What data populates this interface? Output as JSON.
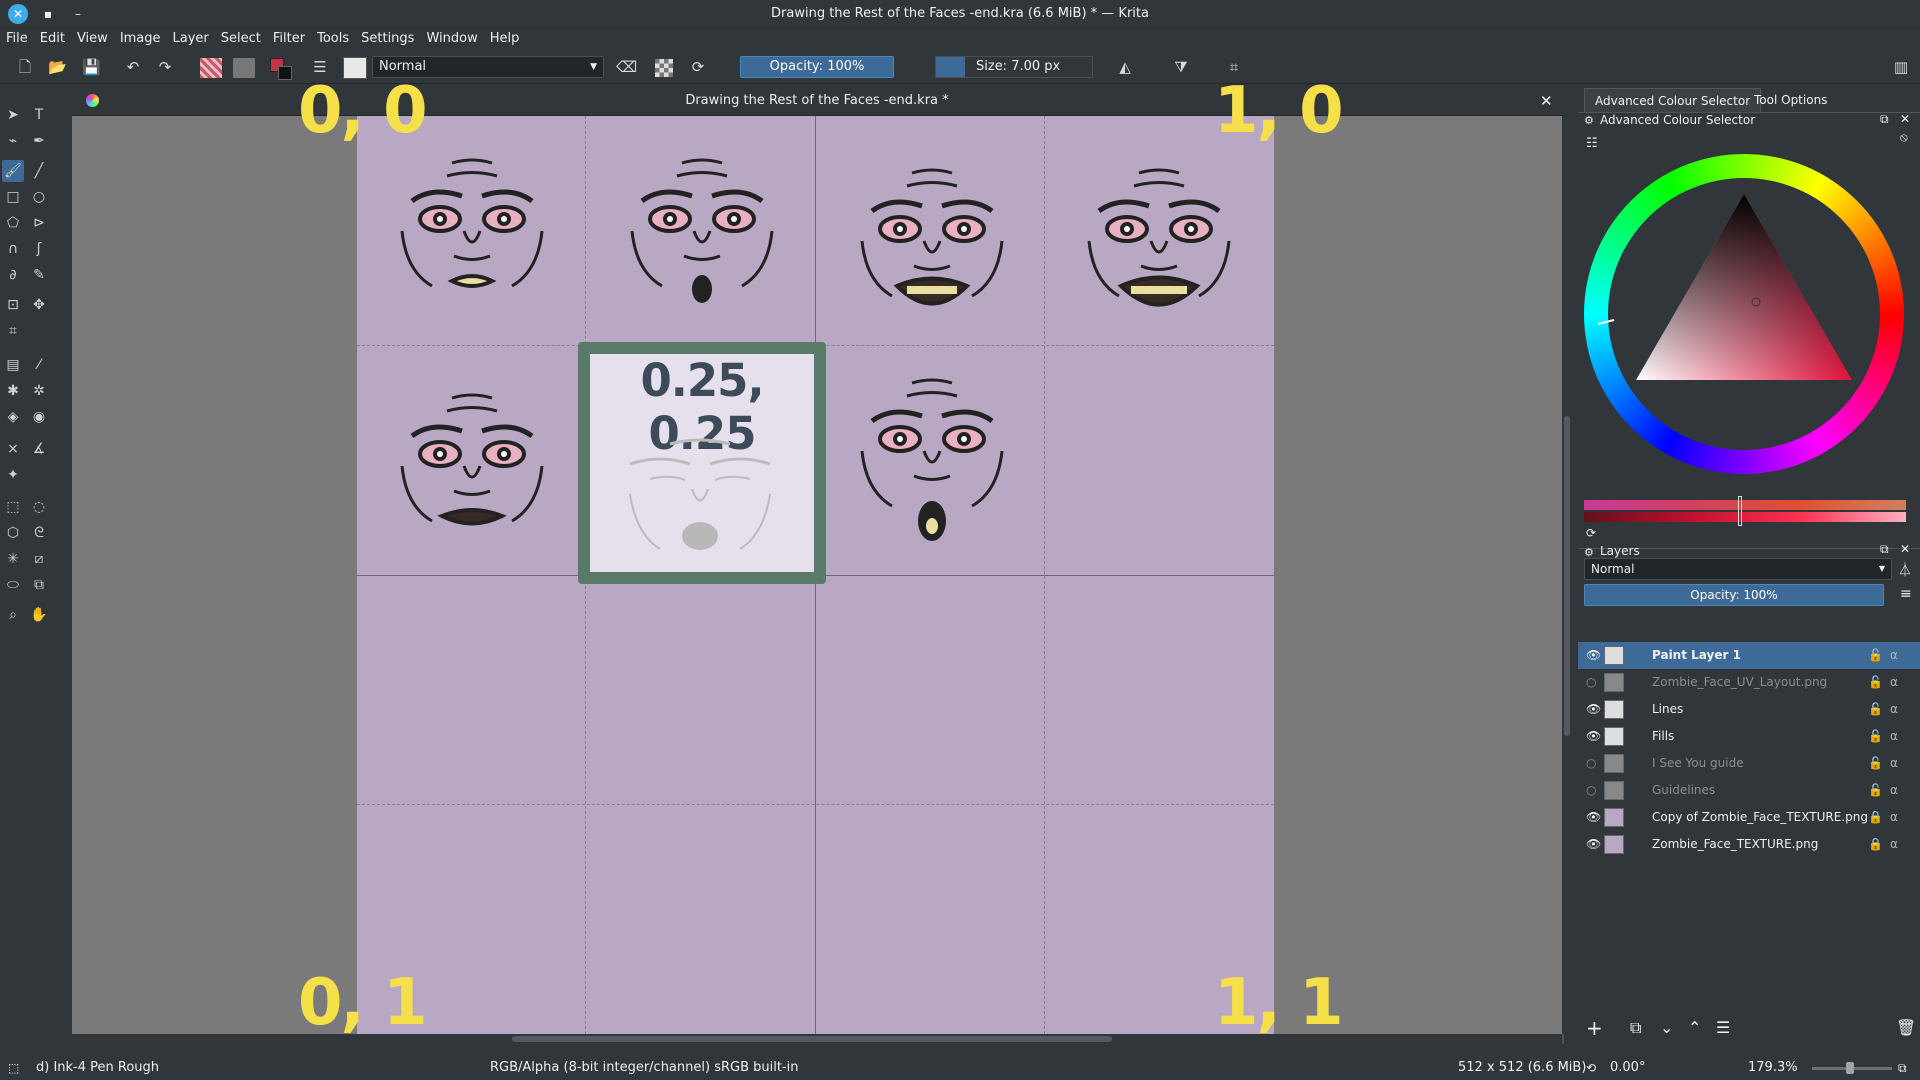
{
  "window": {
    "title": "Drawing the Rest of the Faces -end.kra (6.6 MiB)  * — Krita"
  },
  "menu": [
    "File",
    "Edit",
    "View",
    "Image",
    "Layer",
    "Select",
    "Filter",
    "Tools",
    "Settings",
    "Window",
    "Help"
  ],
  "toolbar": {
    "blend_mode": "Normal",
    "opacity": "Opacity: 100%",
    "size": "Size: 7.00 px"
  },
  "document": {
    "tab_title": "Drawing the Rest of the Faces -end.kra *"
  },
  "canvas": {
    "labels": {
      "top_left": "0, 0",
      "top_right": "1, 0",
      "bottom_left": "0, 1",
      "bottom_right": "1, 1"
    },
    "highlight": "0.25, 0.25"
  },
  "right_panel": {
    "tabs": [
      "Advanced Colour Selector",
      "Tool Options"
    ],
    "colour_selector_title": "Advanced Colour Selector",
    "layers_title": "Layers",
    "layers_blend": "Normal",
    "layers_opacity": "Opacity: 100%",
    "layers": [
      {
        "name": "Paint Layer 1",
        "visible": true,
        "selected": true
      },
      {
        "name": "Zombie_Face_UV_Layout.png",
        "visible": false
      },
      {
        "name": "Lines",
        "visible": true
      },
      {
        "name": "Fills",
        "visible": true
      },
      {
        "name": "I See You guide",
        "visible": false
      },
      {
        "name": "Guidelines",
        "visible": false
      },
      {
        "name": "Copy of Zombie_Face_TEXTURE.png",
        "visible": true
      },
      {
        "name": "Zombie_Face_TEXTURE.png",
        "visible": true
      }
    ],
    "colors": {
      "accent": "#3d6a96",
      "canvas": "#b8a8c4",
      "label": "#f5e04a"
    }
  },
  "status": {
    "brush": "d) Ink-4 Pen Rough",
    "colorspace": "RGB/Alpha (8-bit integer/channel)  sRGB built-in",
    "image_size": "512 x 512 (6.6 MiB)",
    "rotation": "0.00°",
    "zoom": "179.3%"
  }
}
